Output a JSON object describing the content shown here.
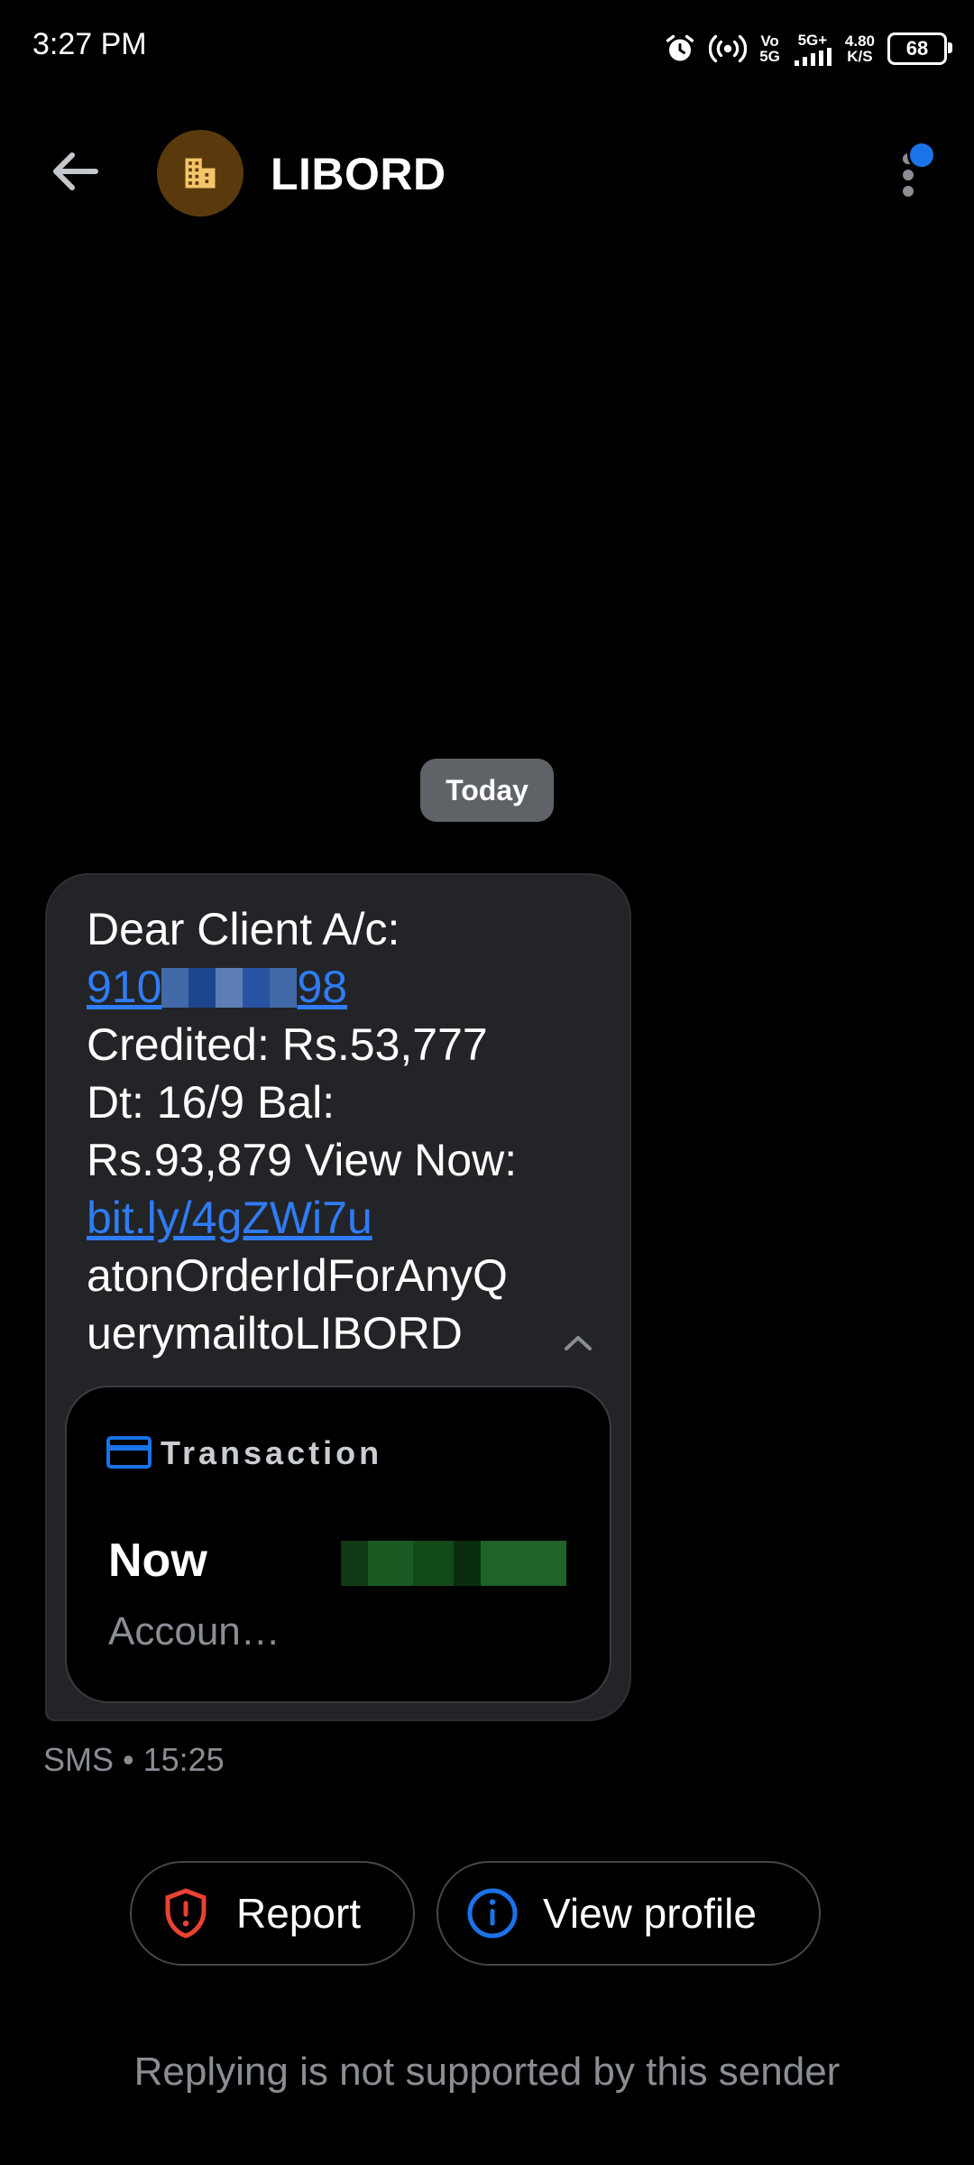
{
  "status_bar": {
    "time": "3:27 PM",
    "network_top": "Vo",
    "network_bottom": "5G",
    "signal_label": "5G+",
    "speed_value": "4.80",
    "speed_unit": "K/S",
    "battery": "68"
  },
  "header": {
    "title": "LIBORD",
    "icons": {
      "back": "arrow-left-icon",
      "avatar": "building-icon",
      "menu": "more-vert-icon"
    }
  },
  "conversation": {
    "date_chip": "Today",
    "message": {
      "line1": "Dear Client A/c:",
      "account_prefix": "910",
      "account_suffix": "98",
      "line3": "Credited: Rs.53,777",
      "line4": "Dt: 16/9 Bal:",
      "line5": "Rs.93,879 View Now:",
      "link": "bit.ly/4gZWi7u",
      "line7": "atonOrderIdForAnyQ",
      "line8": "uerymailtoLIBORD"
    },
    "transaction_card": {
      "label": "Transaction",
      "time": "Now",
      "account": "Accoun…",
      "accent_color": "#1a73e8"
    },
    "meta": "SMS • 15:25"
  },
  "actions": {
    "report_label": "Report",
    "view_profile_label": "View profile",
    "report_color": "#e94235",
    "profile_color": "#1a73e8"
  },
  "footer": {
    "text": "Replying is not supported by this sender"
  }
}
